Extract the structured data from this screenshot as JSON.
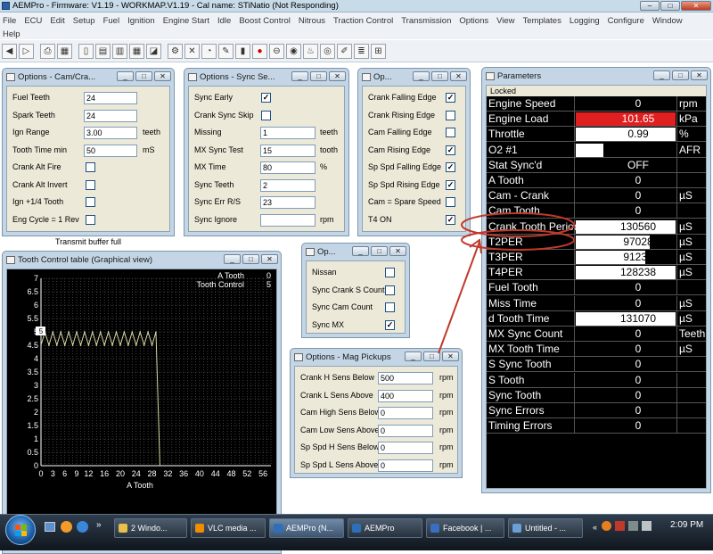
{
  "titlebar": {
    "text": "AEMPro - Firmware: V1.19 - WORKMAP.V1.19 - Cal name: STiNatio (Not Responding)"
  },
  "menu": [
    "File",
    "ECU",
    "Edit",
    "Setup",
    "Fuel",
    "Ignition",
    "Engine Start",
    "Idle",
    "Boost Control",
    "Nitrous",
    "Traction Control",
    "Transmission",
    "Options",
    "View",
    "Templates",
    "Logging",
    "Configure",
    "Window",
    "Help"
  ],
  "cam_window": {
    "title": "Options - Cam/Cra...",
    "rows": [
      {
        "label": "Fuel Teeth",
        "value": "24",
        "unit": ""
      },
      {
        "label": "Spark Teeth",
        "value": "24",
        "unit": ""
      },
      {
        "label": "Ign Range",
        "value": "3.00",
        "unit": "teeth"
      },
      {
        "label": "Tooth Time min",
        "value": "50",
        "unit": "mS"
      },
      {
        "label": "Crank Alt Fire",
        "check": false
      },
      {
        "label": "Crank Alt Invert",
        "check": false
      },
      {
        "label": "Ign +1/4 Tooth",
        "check": false
      },
      {
        "label": "Eng Cycle = 1 Rev",
        "check": false
      }
    ]
  },
  "sync_window": {
    "title": "Options - Sync Se...",
    "rows": [
      {
        "label": "Sync Early",
        "check": true
      },
      {
        "label": "Crank Sync Skip",
        "check": false
      },
      {
        "label": "Missing",
        "value": "1",
        "unit": "teeth"
      },
      {
        "label": "MX Sync Test",
        "value": "15",
        "unit": "tooth"
      },
      {
        "label": "MX Time",
        "value": "80",
        "unit": "%"
      },
      {
        "label": "Sync Teeth",
        "value": "2",
        "unit": ""
      },
      {
        "label": "Sync Err R/S",
        "value": "23",
        "unit": ""
      },
      {
        "label": "Sync Ignore",
        "value": "",
        "unit": "rpm"
      }
    ]
  },
  "op_window": {
    "title": "Op...",
    "rows": [
      {
        "label": "Crank Falling Edge",
        "check": true
      },
      {
        "label": "Crank Rising Edge",
        "check": false
      },
      {
        "label": "Cam Falling Edge",
        "check": false
      },
      {
        "label": "Cam Rising Edge",
        "check": true
      },
      {
        "label": "Sp Spd Falling Edge",
        "check": true
      },
      {
        "label": "Sp Spd Rising Edge",
        "check": true
      },
      {
        "label": "Cam = Spare Speed",
        "check": false
      },
      {
        "label": "T4 ON",
        "check": true
      }
    ]
  },
  "nissan_window": {
    "title": "Op...",
    "rows": [
      {
        "label": "Nissan",
        "check": false
      },
      {
        "label": "Sync Crank S Count",
        "check": false
      },
      {
        "label": "Sync Cam Count",
        "check": false
      },
      {
        "label": "Sync MX",
        "check": true
      }
    ]
  },
  "mag_window": {
    "title": "Options - Mag Pickups",
    "rows": [
      {
        "label": "Crank H Sens Below",
        "value": "500",
        "unit": "rpm"
      },
      {
        "label": "Crank L Sens Above",
        "value": "400",
        "unit": "rpm"
      },
      {
        "label": "Cam High Sens Below",
        "value": "0",
        "unit": "rpm"
      },
      {
        "label": "Cam Low Sens Above",
        "value": "0",
        "unit": "rpm"
      },
      {
        "label": "Sp Spd H Sens Below",
        "value": "0",
        "unit": "rpm"
      },
      {
        "label": "Sp Spd L Sens Above",
        "value": "0",
        "unit": "rpm"
      }
    ]
  },
  "behind_text": "Transmit buffer full",
  "tooth_window": {
    "title": "Tooth Control table (Graphical view)",
    "legend": [
      {
        "name": "A Tooth",
        "value": "0"
      },
      {
        "name": "Tooth Control",
        "value": "5"
      }
    ],
    "marker": "5"
  },
  "chart_data": {
    "type": "line",
    "xlabel": "A Tooth",
    "x_ticks": [
      "0",
      "3",
      "6",
      "9",
      "12",
      "16",
      "20",
      "24",
      "28",
      "32",
      "36",
      "40",
      "44",
      "48",
      "52",
      "56"
    ],
    "y_ticks": [
      "0",
      "0.5",
      "1",
      "1.5",
      "2",
      "2.5",
      "3",
      "3.5",
      "4",
      "4.5",
      "5",
      "5.5",
      "6",
      "6.5",
      "7"
    ],
    "xlim": [
      0,
      58
    ],
    "ylim": [
      0,
      7
    ],
    "grid": true,
    "series": [
      {
        "name": "Tooth Control",
        "color": "#d8d8a0",
        "x": [
          0,
          1,
          2,
          3,
          4,
          5,
          6,
          7,
          8,
          9,
          10,
          11,
          12,
          13,
          14,
          15,
          16,
          17,
          18,
          19,
          20,
          21,
          22,
          23,
          24,
          25,
          26,
          27,
          28,
          29,
          30
        ],
        "values": [
          4.5,
          5,
          4.5,
          5,
          4.5,
          5,
          4.5,
          5,
          4.5,
          5,
          4.5,
          5,
          4.5,
          5,
          4.5,
          5,
          4.5,
          5,
          4.5,
          5,
          4.5,
          5,
          4.5,
          5,
          4.5,
          5,
          4.5,
          5,
          4.5,
          5,
          0
        ]
      }
    ]
  },
  "params": {
    "title": "Parameters",
    "status": "Locked",
    "rows": [
      {
        "name": "Engine Speed",
        "value": "0",
        "unit": "rpm"
      },
      {
        "name": "Engine Load",
        "value": "101.65",
        "unit": "kPa",
        "fill": 1.0,
        "color": "#e02020"
      },
      {
        "name": "Throttle",
        "value": "0.99",
        "unit": "%",
        "fill": 1.0,
        "color": "#ffffff"
      },
      {
        "name": "O2 #1",
        "value": "3.31",
        "unit": "AFR",
        "fill": 0.28,
        "color": "#ffffff"
      },
      {
        "name": "Stat Sync'd",
        "value": "OFF",
        "unit": ""
      },
      {
        "name": "A Tooth",
        "value": "0",
        "unit": ""
      },
      {
        "name": "Cam - Crank",
        "value": "0",
        "unit": "µS"
      },
      {
        "name": "Cam Tooth",
        "value": "0",
        "unit": ""
      },
      {
        "name": "Crank Tooth Period",
        "value": "130560",
        "unit": "µS",
        "fill": 1.0,
        "color": "#ffffff"
      },
      {
        "name": "T2PER",
        "value": "97028",
        "unit": "µS",
        "fill": 0.74,
        "color": "#ffffff"
      },
      {
        "name": "T3PER",
        "value": "91238",
        "unit": "µS",
        "fill": 0.7,
        "color": "#ffffff"
      },
      {
        "name": "T4PER",
        "value": "128238",
        "unit": "µS",
        "fill": 1.0,
        "color": "#ffffff"
      },
      {
        "name": "Fuel Tooth",
        "value": "0",
        "unit": ""
      },
      {
        "name": "Miss Time",
        "value": "0",
        "unit": "µS"
      },
      {
        "name": "d Tooth Time",
        "value": "131070",
        "unit": "µS",
        "fill": 1.0,
        "color": "#ffffff"
      },
      {
        "name": "MX Sync Count",
        "value": "0",
        "unit": "Teeth"
      },
      {
        "name": "MX Tooth Time",
        "value": "0",
        "unit": "µS"
      },
      {
        "name": "S Sync Tooth",
        "value": "0",
        "unit": ""
      },
      {
        "name": "S Tooth",
        "value": "0",
        "unit": ""
      },
      {
        "name": "Sync Tooth",
        "value": "0",
        "unit": ""
      },
      {
        "name": "Sync Errors",
        "value": "0",
        "unit": ""
      },
      {
        "name": "Timing Errors",
        "value": "0",
        "unit": ""
      }
    ]
  },
  "taskbar": {
    "buttons": [
      "2 Windo...",
      "VLC media ...",
      "AEMPro (N...",
      "AEMPro",
      "Facebook | ...",
      "Untitled - ..."
    ],
    "clock": "2:09 PM"
  }
}
